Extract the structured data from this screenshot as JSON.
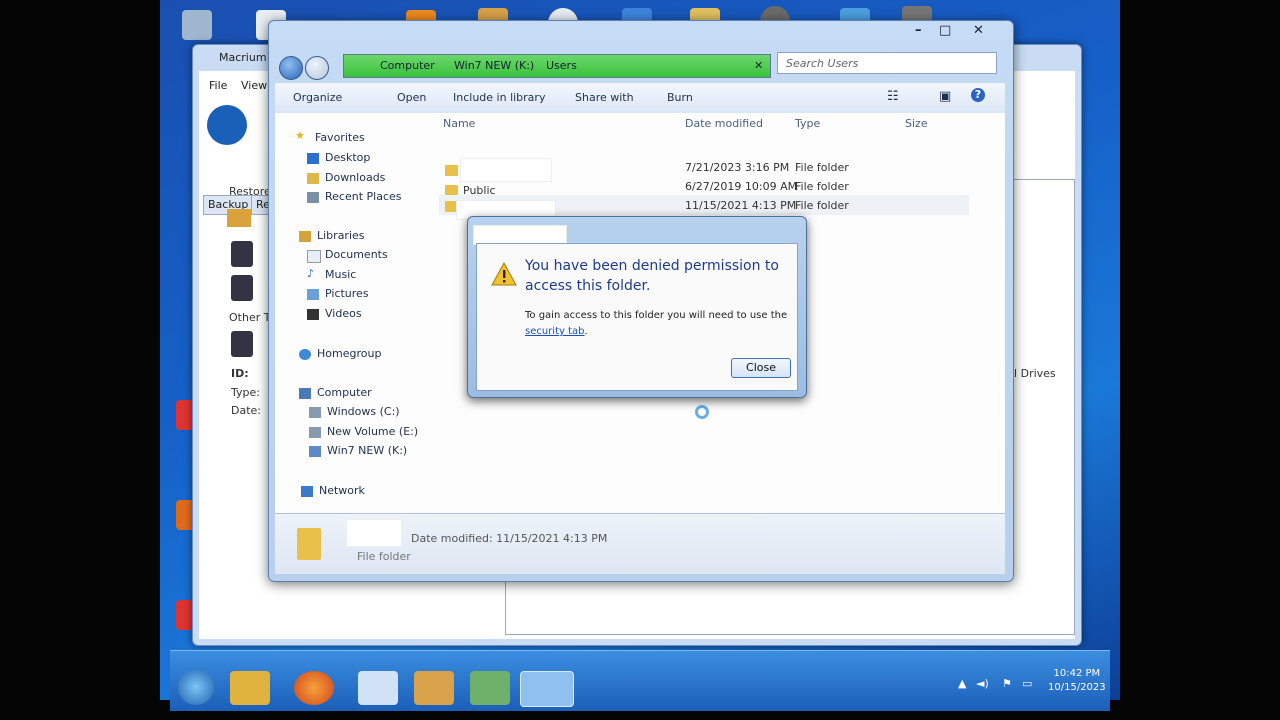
{
  "explorer": {
    "address": [
      "Computer",
      "Win7 NEW (K:)",
      "Users"
    ],
    "search_placeholder": "Search Users",
    "toolbar": {
      "organize": "Organize",
      "open": "Open",
      "include": "Include in library",
      "share": "Share with",
      "burn": "Burn"
    },
    "nav": {
      "favorites": "Favorites",
      "desktop": "Desktop",
      "downloads": "Downloads",
      "recent": "Recent Places",
      "libraries": "Libraries",
      "documents": "Documents",
      "music": "Music",
      "pictures": "Pictures",
      "videos": "Videos",
      "homegroup": "Homegroup",
      "computer": "Computer",
      "drive_c": "Windows (C:)",
      "drive_e": "New Volume (E:)",
      "drive_k": "Win7 NEW (K:)",
      "network": "Network"
    },
    "columns": {
      "name": "Name",
      "date": "Date modified",
      "type": "Type",
      "size": "Size"
    },
    "rows": [
      {
        "name": "",
        "date": "7/21/2023 3:16 PM",
        "type": "File folder"
      },
      {
        "name": "Public",
        "date": "6/27/2019 10:09 AM",
        "type": "File folder"
      },
      {
        "name": "",
        "date": "11/15/2021 4:13 PM",
        "type": "File folder"
      }
    ],
    "details": {
      "modified": "Date modified: 11/15/2021 4:13 PM",
      "kind": "File folder"
    }
  },
  "dialog": {
    "heading": "You have been denied permission to access this folder.",
    "body": "To gain access to this folder you will need to use the",
    "link": "security tab",
    "close": "Close"
  },
  "macrium": {
    "title": "Macrium",
    "menu_file": "File",
    "menu_view": "View",
    "tab_backup": "Backup",
    "tab_restore": "Res",
    "restore": "Restore",
    "other": "Other Ta",
    "id_label": "ID:",
    "type_label": "Type:",
    "date_label": "Date:",
    "drives": "ll Drives"
  },
  "taskbar": {
    "time": "10:42 PM",
    "date": "10/15/2023"
  },
  "colors": {
    "accent": "#1d3b8a",
    "address_bar": "#3cc23c",
    "folder": "#e8c04a"
  }
}
